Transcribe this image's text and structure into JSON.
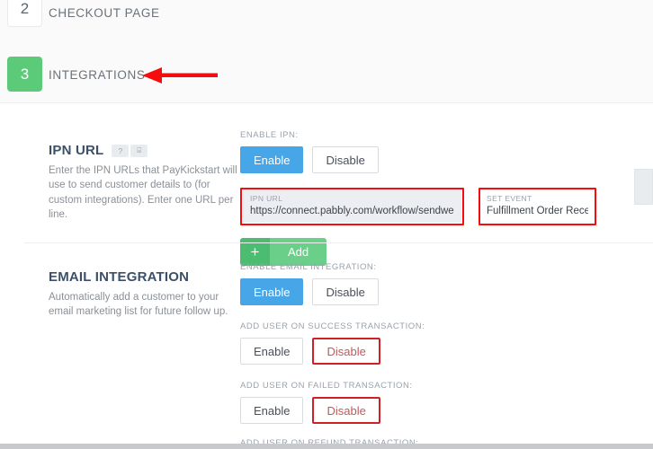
{
  "steps": [
    {
      "number": "2",
      "label": "CHECKOUT PAGE",
      "state": "inactive"
    },
    {
      "number": "3",
      "label": "INTEGRATIONS",
      "state": "active"
    }
  ],
  "annotation": {
    "arrow_color": "#f60c0c",
    "points_to": "INTEGRATIONS"
  },
  "colors": {
    "active_step": "#5ccb79",
    "enable_active": "#46a6e8",
    "disable_active": "#cf2026",
    "highlight": "#f60c0c",
    "add_button": "#6ad089",
    "heading": "#3c5069"
  },
  "sections": [
    {
      "title": "IPN URL",
      "badges": [
        "?",
        "⌸"
      ],
      "description": "Enter the IPN URLs that PayKickstart will use to send customer details to (for custom integrations). Enter one URL per line.",
      "toggle_label": "ENABLE IPN:",
      "enable_label": "Enable",
      "disable_label": "Disable",
      "enable_state": "on",
      "ipn_field": {
        "label": "IPN URL",
        "value": "https://connect.pabbly.com/workflow/sendwebhookdata",
        "highlighted": true
      },
      "event_field": {
        "label": "SET EVENT",
        "value": "Fulfillment Order Received",
        "highlighted": true
      },
      "add_button": {
        "icon": "+",
        "label": "Add"
      }
    },
    {
      "title": "EMAIL INTEGRATION",
      "badges": [],
      "description": "Automatically add a customer to your email marketing list for future follow up.",
      "toggle_label": "ENABLE EMAIL INTEGRATION:",
      "enable_label": "Enable",
      "disable_label": "Disable",
      "enable_state": "on",
      "sub_toggles": [
        {
          "label": "ADD USER ON SUCCESS TRANSACTION:",
          "enable_label": "Enable",
          "disable_label": "Disable",
          "state": "disabled"
        },
        {
          "label": "ADD USER ON FAILED TRANSACTION:",
          "enable_label": "Enable",
          "disable_label": "Disable",
          "state": "disabled"
        },
        {
          "label": "ADD USER ON REFUND TRANSACTION:",
          "enable_label": "",
          "disable_label": "",
          "state": "cut-off"
        }
      ]
    }
  ]
}
